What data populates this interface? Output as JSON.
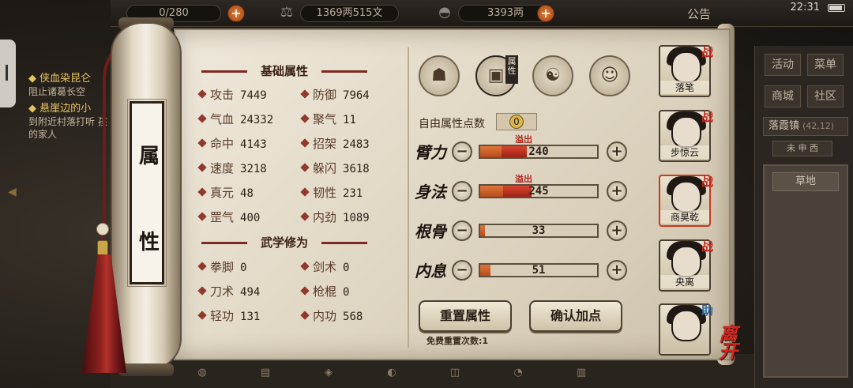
{
  "topbar": {
    "stamina": "0/280",
    "copper": "1369两515文",
    "silver": "3393两",
    "notice": "公告",
    "time": "22:31"
  },
  "quest": {
    "q1_title": "◆ 侠血染昆仑",
    "q1_desc": "阻止诸葛长空",
    "q2_title": "◆ 悬崖边的小",
    "q2_desc": "到附近村落打听 孩的家人"
  },
  "scroll": {
    "title_top": "属",
    "title_bottom": "性"
  },
  "basic": {
    "title": "基础属性",
    "items": [
      {
        "label": "攻击",
        "value": "7449"
      },
      {
        "label": "防御",
        "value": "7964"
      },
      {
        "label": "气血",
        "value": "24332"
      },
      {
        "label": "聚气",
        "value": "11"
      },
      {
        "label": "命中",
        "value": "4143"
      },
      {
        "label": "招架",
        "value": "2483"
      },
      {
        "label": "速度",
        "value": "3218"
      },
      {
        "label": "躲闪",
        "value": "3618"
      },
      {
        "label": "真元",
        "value": "48"
      },
      {
        "label": "韧性",
        "value": "231"
      },
      {
        "label": "罡气",
        "value": "400"
      },
      {
        "label": "内劲",
        "value": "1089"
      }
    ]
  },
  "martial": {
    "title": "武学修为",
    "items": [
      {
        "label": "拳脚",
        "value": "0"
      },
      {
        "label": "剑术",
        "value": "0"
      },
      {
        "label": "刀术",
        "value": "494"
      },
      {
        "label": "枪棍",
        "value": "0"
      },
      {
        "label": "轻功",
        "value": "131"
      },
      {
        "label": "内功",
        "value": "568"
      }
    ]
  },
  "right": {
    "tag": "属性",
    "free_label": "自由属性点数",
    "free_value": "0",
    "stats": [
      {
        "name": "臂力",
        "value": "240",
        "overflow": "溢出",
        "fill": 0.4
      },
      {
        "name": "身法",
        "value": "245",
        "overflow": "溢出",
        "fill": 0.44
      },
      {
        "name": "根骨",
        "value": "33",
        "overflow": "",
        "fill": 0.04
      },
      {
        "name": "内息",
        "value": "51",
        "overflow": "",
        "fill": 0.09
      }
    ],
    "minus": "−",
    "plus": "+",
    "reset_button": "重置属性",
    "confirm_button": "确认加点",
    "reset_note": "免费重置次数:1"
  },
  "party": [
    {
      "name": "落笔",
      "badge": "战"
    },
    {
      "name": "步惊云",
      "badge": "战"
    },
    {
      "name": "商昊乾",
      "badge": "战"
    },
    {
      "name": "央离",
      "badge": "战"
    },
    {
      "name": "",
      "badge": "助"
    }
  ],
  "leave": "离开",
  "rightmenu": {
    "activity": "活动",
    "menu": "菜单",
    "shop": "商城",
    "community": "社区",
    "location": "落霞镇",
    "coords": "(42,12)",
    "minimap_label": "草地",
    "compass": "未 申 西"
  }
}
